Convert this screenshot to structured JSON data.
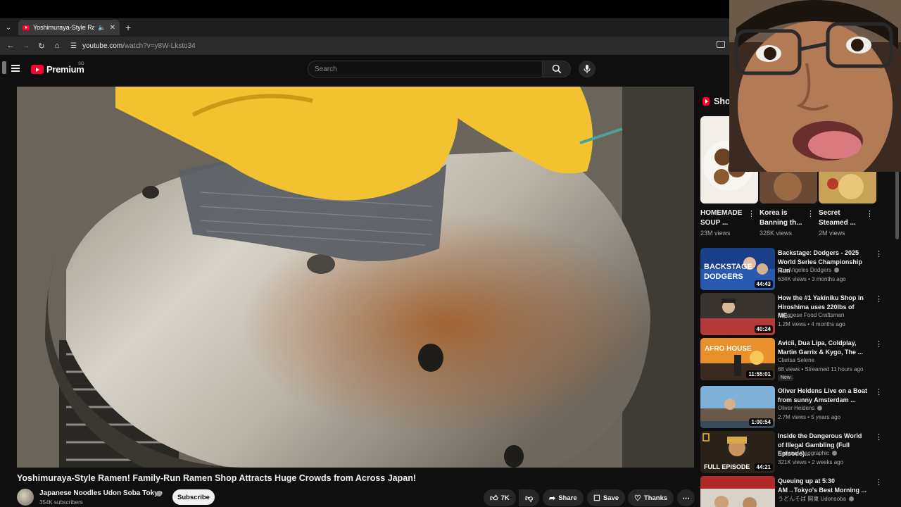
{
  "browser": {
    "tab_title": "Yoshimuraya-Style Ramen!",
    "url_host": "youtube.com",
    "url_path": "/watch?v=y8W-Lksto34"
  },
  "header": {
    "logo_text": "Premium",
    "logo_region": "SG",
    "search_placeholder": "Search"
  },
  "video": {
    "title": "Yoshimuraya-Style Ramen! Family-Run Ramen Shop Attracts Huge Crowds from Across Japan!",
    "channel": "Japanese Noodles Udon Soba Tokyo",
    "subscribers": "354K subscribers",
    "subscribe_label": "Subscribe",
    "likes": "7K",
    "share_label": "Share",
    "save_label": "Save",
    "thanks_label": "Thanks"
  },
  "sidebar": {
    "shorts_heading": "Shor",
    "shorts": [
      {
        "title": "HOMEMADE SOUP ...",
        "views": "23M views"
      },
      {
        "title": "Korea is Banning th...",
        "views": "328K views"
      },
      {
        "title": "Secret Steamed ...",
        "views": "2M views"
      }
    ],
    "recommended": [
      {
        "title": "Backstage: Dodgers - 2025 World Series Championship Run",
        "channel": "Los Angeles Dodgers",
        "verified": true,
        "meta": "634K views • 3 months ago",
        "duration": "44:43",
        "badge": "",
        "thumb_text": "BACKSTAGE\nDODGERS"
      },
      {
        "title": "How the #1 Yakiniku Shop in Hiroshima uses 220lbs of ME...",
        "channel": "Japanese Food Craftsman",
        "verified": false,
        "meta": "1.2M views • 4 months ago",
        "duration": "40:24",
        "badge": "",
        "thumb_text": ""
      },
      {
        "title": "Avicii, Dua Lipa, Coldplay, Martin Garrix & Kygo, The ...",
        "channel": "Clarisa Selene",
        "verified": false,
        "meta": "68 views • Streamed 11 hours ago",
        "duration": "11:55:01",
        "badge": "New",
        "thumb_text": "AFRO HOUSE"
      },
      {
        "title": "Oliver Heldens Live on a Boat from sunny Amsterdam ...",
        "channel": "Oliver Heldens",
        "verified": true,
        "meta": "2.7M views • 5 years ago",
        "duration": "1:00:54",
        "badge": "",
        "thumb_text": ""
      },
      {
        "title": "Inside the Dangerous World of Illegal Gambling (Full Episode)...",
        "channel": "National Geographic",
        "verified": true,
        "meta": "321K views • 2 weeks ago",
        "duration": "44:21",
        "badge": "",
        "thumb_text": "FULL EPISODE"
      },
      {
        "title": "Queuing up at 5:30 AM→Tokyo's Best Morning ...",
        "channel": "うどんそば 開東 Udonsoba",
        "verified": true,
        "meta": "",
        "duration": "",
        "badge": "",
        "thumb_text": ""
      }
    ]
  },
  "colors": {
    "brand_red": "#ff0033",
    "background": "#0f0f0f",
    "glove_yellow": "#f2c230"
  },
  "icons": [
    "menu-icon",
    "search-icon",
    "mic-icon",
    "like-icon",
    "dislike-icon",
    "share-icon",
    "save-icon",
    "thanks-icon",
    "more-icon"
  ]
}
